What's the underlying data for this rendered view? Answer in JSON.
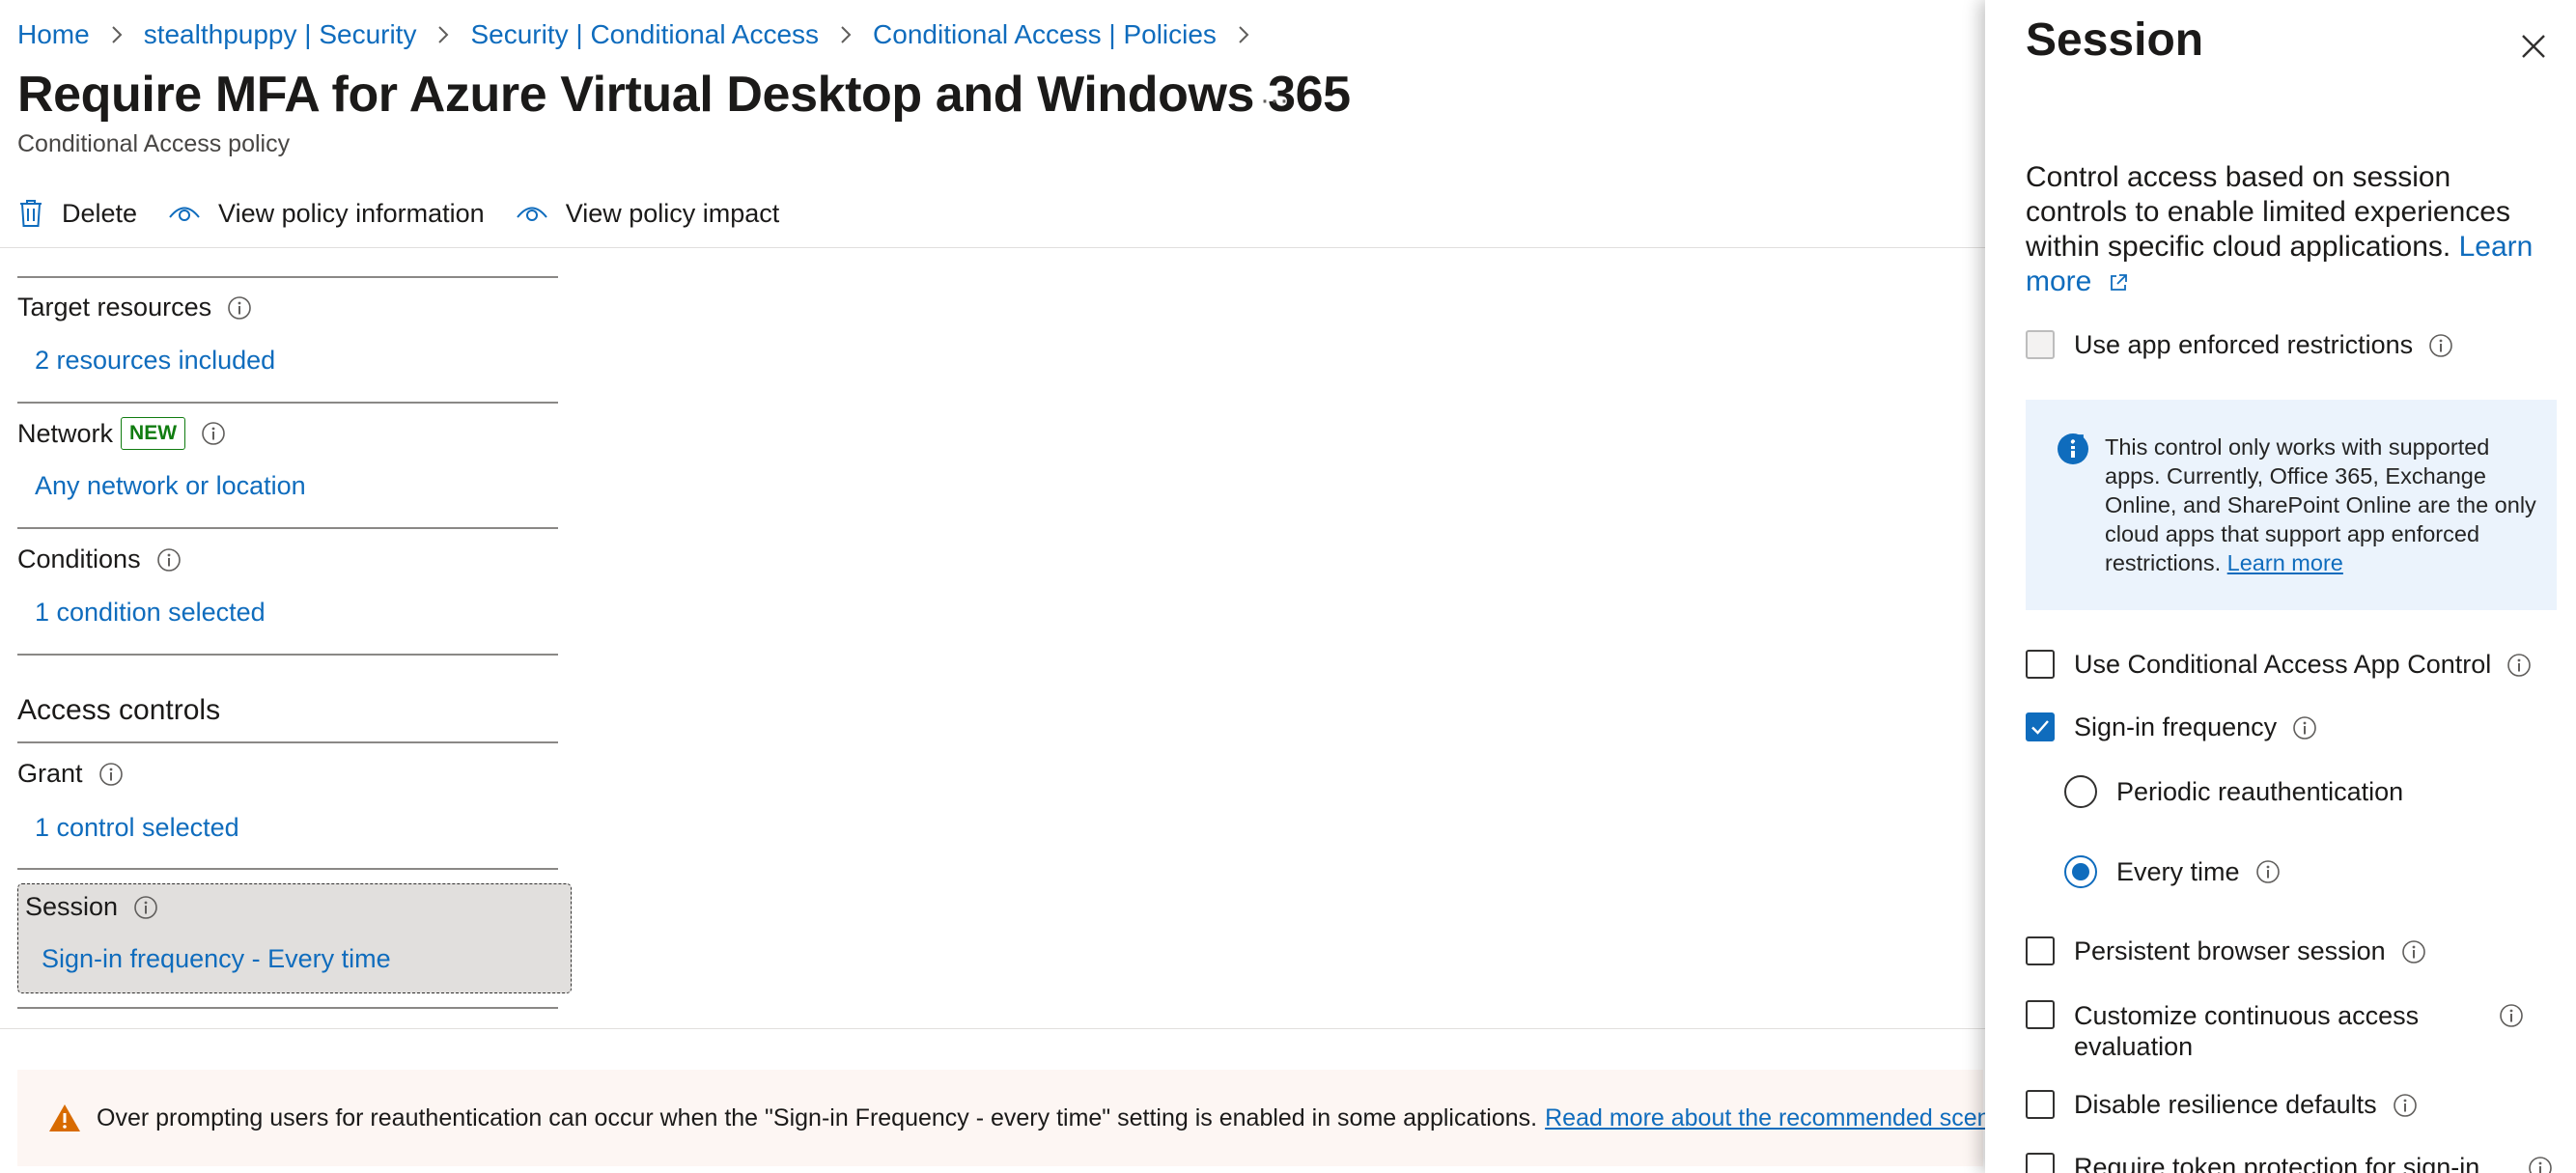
{
  "breadcrumb": [
    "Home",
    "stealthpuppy | Security",
    "Security | Conditional Access",
    "Conditional Access | Policies"
  ],
  "page": {
    "title": "Require MFA for Azure Virtual Desktop and Windows 365",
    "more": "···",
    "subtitle": "Conditional Access policy"
  },
  "toolbar": {
    "delete": "Delete",
    "view_info": "View policy information",
    "view_impact": "View policy impact"
  },
  "sections": {
    "target": {
      "label": "Target resources",
      "value": "2 resources included"
    },
    "network": {
      "label": "Network",
      "badge": "NEW",
      "value": "Any network or location"
    },
    "conditions": {
      "label": "Conditions",
      "value": "1 condition selected"
    },
    "access_controls": "Access controls",
    "grant": {
      "label": "Grant",
      "value": "1 control selected"
    },
    "session": {
      "label": "Session",
      "value": "Sign-in frequency - Every time"
    }
  },
  "warning": {
    "text": "Over prompting users for reauthentication can occur when the \"Sign-in Frequency - every time\" setting is enabled in some applications.",
    "link": "Read more about the recommended scenarios."
  },
  "panel": {
    "title": "Session",
    "description": "Control access based on session controls to enable limited experiences within specific cloud applications.",
    "learn_more": "Learn more",
    "app_enforced": {
      "label": "Use app enforced restrictions",
      "checked": false,
      "disabled": true
    },
    "info_text": "This control only works with supported apps. Currently, Office 365, Exchange Online, and SharePoint Online are the only cloud apps that support app enforced restrictions.",
    "info_link": "Learn more",
    "ca_app_control": {
      "label": "Use Conditional Access App Control",
      "checked": false
    },
    "sign_in_frequency": {
      "label": "Sign-in frequency",
      "checked": true
    },
    "periodic": {
      "label": "Periodic reauthentication",
      "selected": false
    },
    "every_time": {
      "label": "Every time",
      "selected": true
    },
    "persistent": {
      "label": "Persistent browser session",
      "checked": false
    },
    "cae": {
      "label": "Customize continuous access evaluation",
      "checked": false
    },
    "resilience": {
      "label": "Disable resilience defaults",
      "checked": false
    },
    "token": {
      "label": "Require token protection for sign-in",
      "checked": false
    }
  },
  "colors": {
    "accent": "#0f6cbd",
    "warning": "#d86b00",
    "new_badge": "#107c10",
    "info_bg": "#ebf3fc"
  }
}
